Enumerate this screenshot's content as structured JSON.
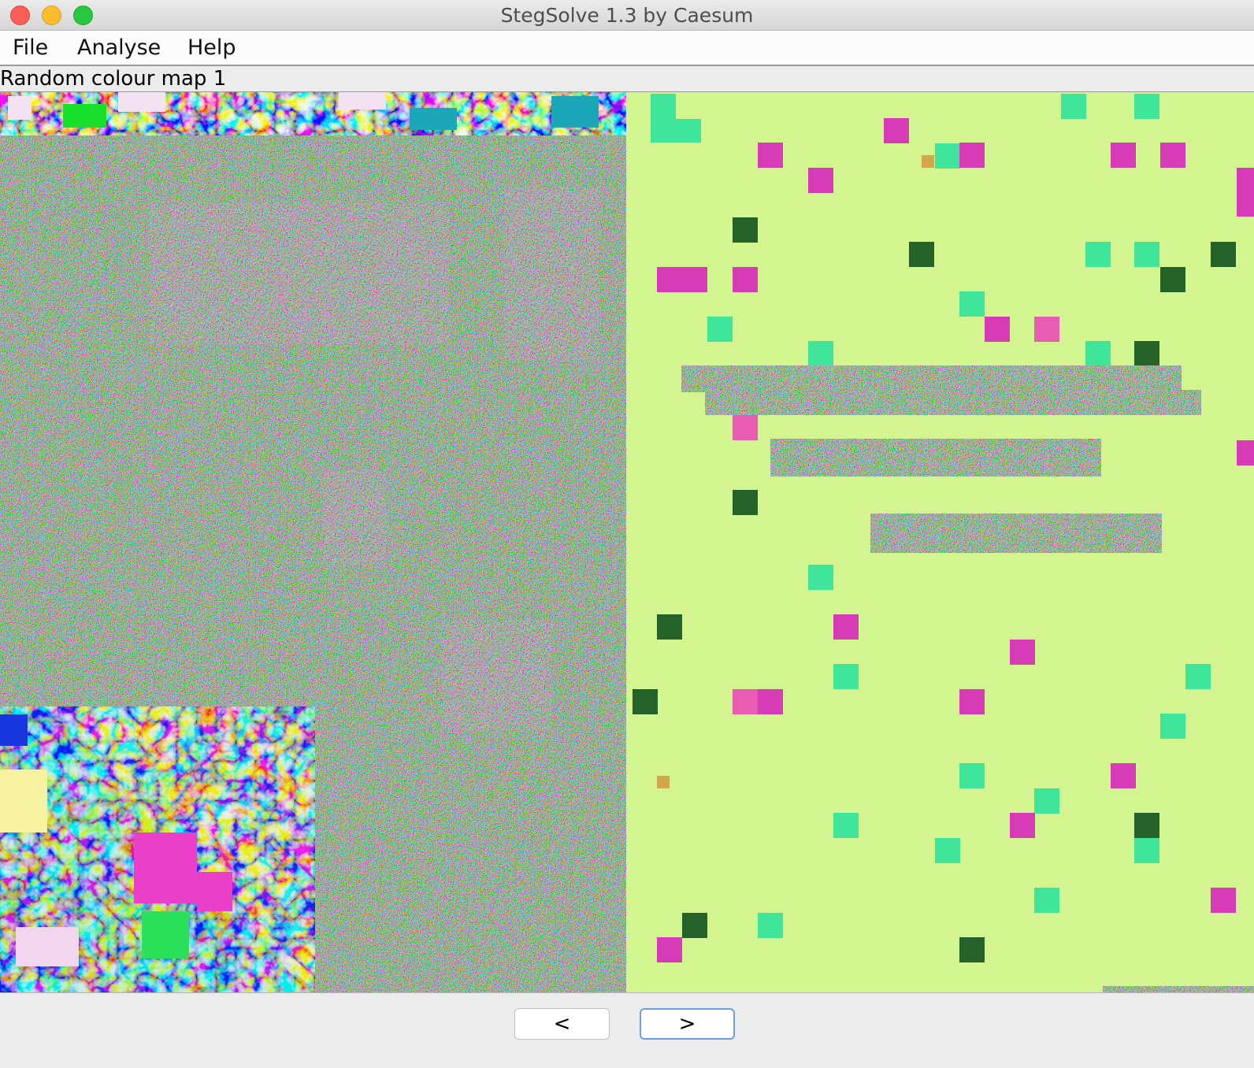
{
  "window": {
    "title": "StegSolve 1.3 by Caesum"
  },
  "menu": {
    "items": [
      "File",
      "Analyse",
      "Help"
    ]
  },
  "viewer": {
    "mode_label": "Random colour map 1"
  },
  "nav": {
    "prev_label": "<",
    "next_label": ">"
  },
  "colors": {
    "background_light_green": "#d2f58f",
    "mint": "#3fe59a",
    "magenta": "#d83bb6",
    "pink": "#e85cb2",
    "dark_green": "#24622a",
    "mustard": "#d3a84a"
  }
}
